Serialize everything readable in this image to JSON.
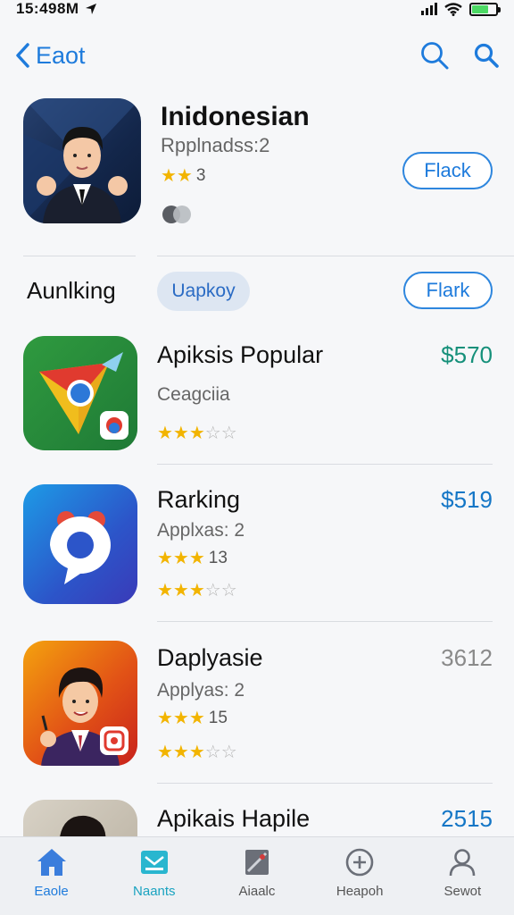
{
  "status_bar": {
    "time": "15:498M"
  },
  "nav": {
    "back_label": "Eaot"
  },
  "hero": {
    "title": "Inidonesian",
    "subtitle": "Rpplnadss:2",
    "rating_count": "3",
    "button_label": "Flack"
  },
  "section": {
    "title": "Aunlking",
    "chip_label": "Uapkoy",
    "button_label": "Flark"
  },
  "apps": [
    {
      "title": "Apiksis Popular",
      "subtitle": "Ceagciia",
      "price": "$570",
      "rating": 3,
      "rating_extra": ""
    },
    {
      "title": "Rarking",
      "subtitle": "Applxas: 2",
      "price": "$519",
      "rating": 3,
      "rating_extra": "13"
    },
    {
      "title": "Daplyasie",
      "subtitle": "Applyas: 2",
      "price": "3612",
      "rating": 3,
      "rating_extra": "15"
    },
    {
      "title": "Apikais Hapile",
      "subtitle": "",
      "price": "2515",
      "rating": 0,
      "rating_extra": ""
    }
  ],
  "tabs": [
    {
      "label": "Eaole",
      "icon": "home-icon"
    },
    {
      "label": "Naants",
      "icon": "apps-icon"
    },
    {
      "label": "Aiaalc",
      "icon": "games-icon"
    },
    {
      "label": "Heapoh",
      "icon": "add-circle-icon"
    },
    {
      "label": "Sewot",
      "icon": "person-icon"
    }
  ],
  "colors": {
    "accent": "#1e7bdc",
    "star": "#f2b400",
    "price_teal": "#15907a"
  }
}
